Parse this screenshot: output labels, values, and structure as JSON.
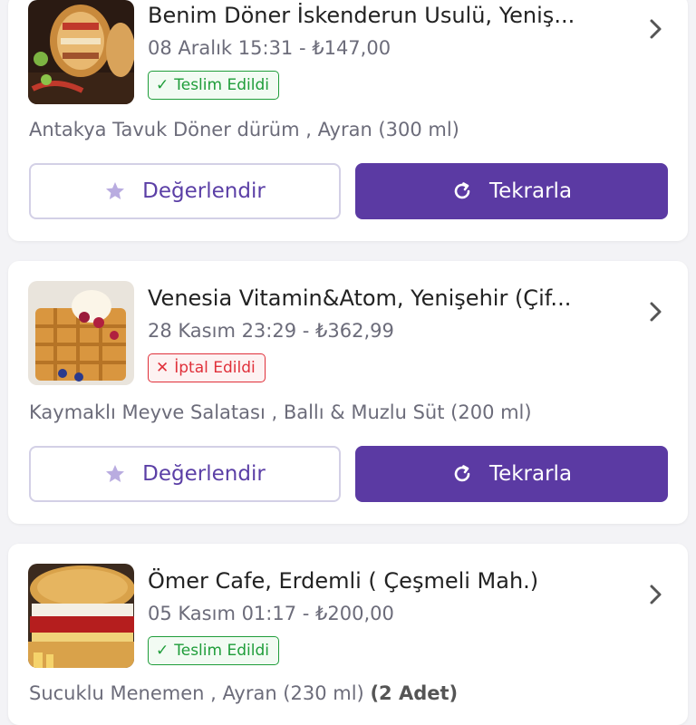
{
  "orders": [
    {
      "restaurant": "Benim Döner İskenderun Usulü, Yeniş...",
      "date_price": "08 Aralık 15:31 - ₺147,00",
      "status": "Teslim Edildi",
      "status_type": "delivered",
      "items": "Antakya Tavuk Döner dürüm , Ayran (300 ml)",
      "quantity_note": "",
      "rate_label": "Değerlendir",
      "repeat_label": "Tekrarla",
      "thumb_icon": "doner-wrap-photo"
    },
    {
      "restaurant": "Venesia Vitamin&Atom, Yenişehir (Çif...",
      "date_price": "28 Kasım 23:29 - ₺362,99",
      "status": "İptal Edildi",
      "status_type": "cancelled",
      "items": "Kaymaklı Meyve Salatası , Ballı & Muzlu Süt (200 ml)",
      "quantity_note": "",
      "rate_label": "Değerlendir",
      "repeat_label": "Tekrarla",
      "thumb_icon": "waffle-photo"
    },
    {
      "restaurant": "Ömer Cafe, Erdemli ( Çeşmeli Mah.)",
      "date_price": "05 Kasım 01:17 - ₺200,00",
      "status": "Teslim Edildi",
      "status_type": "delivered",
      "items": "Sucuklu Menemen , Ayran (230 ml)",
      "quantity_note": "(2 Adet)",
      "thumb_icon": "toast-sandwich-photo"
    }
  ],
  "colors": {
    "primary": "#5b3aa3",
    "delivered": "#1f9d3a",
    "cancelled": "#e0303a",
    "star": "#b9ace0"
  }
}
